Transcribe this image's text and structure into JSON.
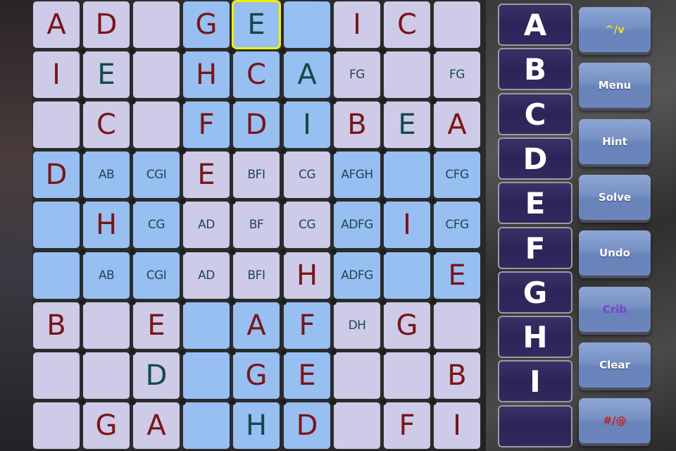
{
  "board": {
    "rows": [
      [
        {
          "v": "A",
          "t": "given",
          "bg": "light"
        },
        {
          "v": "D",
          "t": "given",
          "bg": "light"
        },
        {
          "v": "",
          "t": "empty",
          "bg": "light"
        },
        {
          "v": "G",
          "t": "given",
          "bg": "blue"
        },
        {
          "v": "E",
          "t": "user",
          "bg": "blue",
          "selected": true
        },
        {
          "v": "",
          "t": "empty",
          "bg": "blue"
        },
        {
          "v": "I",
          "t": "given",
          "bg": "light"
        },
        {
          "v": "C",
          "t": "given",
          "bg": "light"
        },
        {
          "v": "",
          "t": "empty",
          "bg": "light"
        }
      ],
      [
        {
          "v": "I",
          "t": "given",
          "bg": "light"
        },
        {
          "v": "E",
          "t": "user",
          "bg": "light"
        },
        {
          "v": "",
          "t": "empty",
          "bg": "light"
        },
        {
          "v": "H",
          "t": "given",
          "bg": "blue"
        },
        {
          "v": "C",
          "t": "given",
          "bg": "blue"
        },
        {
          "v": "A",
          "t": "user",
          "bg": "blue"
        },
        {
          "v": "FG",
          "t": "pencil",
          "bg": "light"
        },
        {
          "v": "",
          "t": "empty",
          "bg": "light"
        },
        {
          "v": "FG",
          "t": "pencil",
          "bg": "light"
        }
      ],
      [
        {
          "v": "",
          "t": "empty",
          "bg": "light"
        },
        {
          "v": "C",
          "t": "given",
          "bg": "light"
        },
        {
          "v": "",
          "t": "empty",
          "bg": "light"
        },
        {
          "v": "F",
          "t": "given",
          "bg": "blue"
        },
        {
          "v": "D",
          "t": "given",
          "bg": "blue"
        },
        {
          "v": "I",
          "t": "user",
          "bg": "blue"
        },
        {
          "v": "B",
          "t": "given",
          "bg": "light"
        },
        {
          "v": "E",
          "t": "user",
          "bg": "light"
        },
        {
          "v": "A",
          "t": "given",
          "bg": "light"
        }
      ],
      [
        {
          "v": "D",
          "t": "given",
          "bg": "blue"
        },
        {
          "v": "AB",
          "t": "pencil",
          "bg": "blue"
        },
        {
          "v": "CGI",
          "t": "pencil",
          "bg": "blue"
        },
        {
          "v": "E",
          "t": "given",
          "bg": "light"
        },
        {
          "v": "BFI",
          "t": "pencil",
          "bg": "light"
        },
        {
          "v": "CG",
          "t": "pencil",
          "bg": "light"
        },
        {
          "v": "AFGH",
          "t": "pencil",
          "bg": "blue"
        },
        {
          "v": "",
          "t": "empty",
          "bg": "blue"
        },
        {
          "v": "CFG",
          "t": "pencil",
          "bg": "blue"
        }
      ],
      [
        {
          "v": "",
          "t": "empty",
          "bg": "blue"
        },
        {
          "v": "H",
          "t": "given",
          "bg": "blue"
        },
        {
          "v": "CG",
          "t": "pencil",
          "bg": "blue"
        },
        {
          "v": "AD",
          "t": "pencil",
          "bg": "light"
        },
        {
          "v": "BF",
          "t": "pencil",
          "bg": "light"
        },
        {
          "v": "CG",
          "t": "pencil",
          "bg": "light"
        },
        {
          "v": "ADFG",
          "t": "pencil",
          "bg": "blue"
        },
        {
          "v": "I",
          "t": "given",
          "bg": "blue"
        },
        {
          "v": "CFG",
          "t": "pencil",
          "bg": "blue"
        }
      ],
      [
        {
          "v": "",
          "t": "empty",
          "bg": "blue"
        },
        {
          "v": "AB",
          "t": "pencil",
          "bg": "blue"
        },
        {
          "v": "CGI",
          "t": "pencil",
          "bg": "blue"
        },
        {
          "v": "AD",
          "t": "pencil",
          "bg": "light"
        },
        {
          "v": "BFI",
          "t": "pencil",
          "bg": "light"
        },
        {
          "v": "H",
          "t": "given",
          "bg": "light"
        },
        {
          "v": "ADFG",
          "t": "pencil",
          "bg": "blue"
        },
        {
          "v": "",
          "t": "empty",
          "bg": "blue"
        },
        {
          "v": "E",
          "t": "given",
          "bg": "blue"
        }
      ],
      [
        {
          "v": "B",
          "t": "given",
          "bg": "light"
        },
        {
          "v": "",
          "t": "empty",
          "bg": "light"
        },
        {
          "v": "E",
          "t": "given",
          "bg": "light"
        },
        {
          "v": "",
          "t": "empty",
          "bg": "blue"
        },
        {
          "v": "A",
          "t": "given",
          "bg": "blue"
        },
        {
          "v": "F",
          "t": "given",
          "bg": "blue"
        },
        {
          "v": "DH",
          "t": "pencil",
          "bg": "light"
        },
        {
          "v": "G",
          "t": "given",
          "bg": "light"
        },
        {
          "v": "",
          "t": "empty",
          "bg": "light"
        }
      ],
      [
        {
          "v": "",
          "t": "empty",
          "bg": "light"
        },
        {
          "v": "",
          "t": "empty",
          "bg": "light"
        },
        {
          "v": "D",
          "t": "user",
          "bg": "light"
        },
        {
          "v": "",
          "t": "empty",
          "bg": "blue"
        },
        {
          "v": "G",
          "t": "given",
          "bg": "blue"
        },
        {
          "v": "E",
          "t": "given",
          "bg": "blue"
        },
        {
          "v": "",
          "t": "empty",
          "bg": "light"
        },
        {
          "v": "",
          "t": "empty",
          "bg": "light"
        },
        {
          "v": "B",
          "t": "given",
          "bg": "light"
        }
      ],
      [
        {
          "v": "",
          "t": "empty",
          "bg": "light"
        },
        {
          "v": "G",
          "t": "given",
          "bg": "light"
        },
        {
          "v": "A",
          "t": "given",
          "bg": "light"
        },
        {
          "v": "",
          "t": "empty",
          "bg": "blue"
        },
        {
          "v": "H",
          "t": "user",
          "bg": "blue"
        },
        {
          "v": "D",
          "t": "given",
          "bg": "blue"
        },
        {
          "v": "",
          "t": "empty",
          "bg": "light"
        },
        {
          "v": "F",
          "t": "given",
          "bg": "light"
        },
        {
          "v": "I",
          "t": "given",
          "bg": "light"
        }
      ]
    ]
  },
  "letter_pad": {
    "letters": [
      "A",
      "B",
      "C",
      "D",
      "E",
      "F",
      "G",
      "H",
      "I",
      ""
    ]
  },
  "actions": [
    {
      "id": "toggle",
      "label": "^/v",
      "color": "#e8e020"
    },
    {
      "id": "menu",
      "label": "Menu",
      "color": "#ffffff"
    },
    {
      "id": "hint",
      "label": "Hint",
      "color": "#ffffff"
    },
    {
      "id": "solve",
      "label": "Solve",
      "color": "#ffffff"
    },
    {
      "id": "undo",
      "label": "Undo",
      "color": "#ffffff"
    },
    {
      "id": "crib",
      "label": "Crib",
      "color": "#7a3fd0"
    },
    {
      "id": "clear",
      "label": "Clear",
      "color": "#ffffff"
    },
    {
      "id": "symbols",
      "label": "#/@",
      "color": "#cc1a1a"
    }
  ],
  "colors": {
    "given_text": "#7a1518",
    "user_text": "#124a4a",
    "cell_light": "#cdcbe7",
    "cell_blue": "#97bff2",
    "selection": "#f3f000"
  }
}
